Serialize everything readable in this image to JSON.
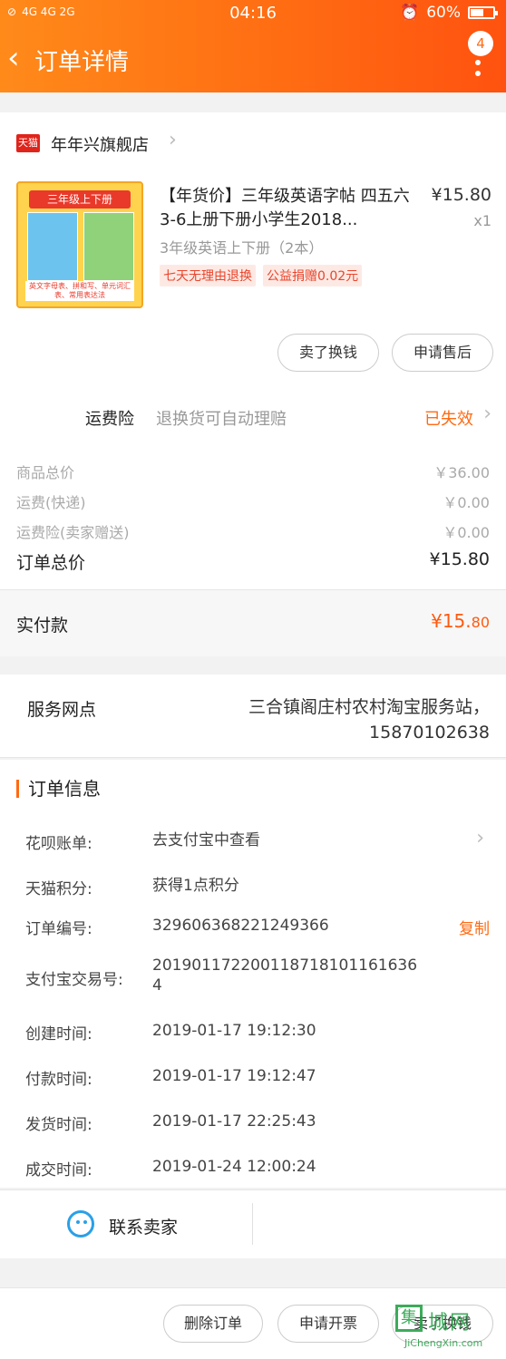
{
  "status_bar": {
    "network": "4G 4G 2G",
    "time": "04:16",
    "battery": "60%",
    "battery_level": 0.6
  },
  "nav": {
    "title": "订单详情",
    "badge": "4"
  },
  "store": {
    "logo_text": "天猫",
    "name": "年年兴旗舰店"
  },
  "product": {
    "title": "【年货价】三年级英语字帖 四五六3-6上册下册小学生2018...",
    "price": "¥15.80",
    "qty": "x1",
    "sku": "3年级英语上下册（2本）",
    "tags": [
      "七天无理由退换",
      "公益捐赠0.02元"
    ],
    "thumb_title": "三年级上下册",
    "thumb_caption": "英文字母表、拼和写、单元词汇表、常用表达法"
  },
  "item_actions": {
    "sell": "卖了换钱",
    "aftersale": "申请售后"
  },
  "insurance": {
    "label": "运费险",
    "desc": "退换货可自动理赔",
    "status": "已失效"
  },
  "fees": {
    "goods_label": "商品总价",
    "goods_value": "￥36.00",
    "shipping_label": "运费(快递)",
    "shipping_value": "￥0.00",
    "insurance_label": "运费险(卖家赠送)",
    "insurance_value": "￥0.00",
    "total_label": "订单总价",
    "total_value": "¥15.80"
  },
  "paid": {
    "label": "实付款",
    "value_int": "¥15.",
    "value_dec": "80"
  },
  "service": {
    "label": "服务网点",
    "line1": "三合镇阁庄村农村淘宝服务站，",
    "line2": "15870102638"
  },
  "order_info": {
    "heading": "订单信息",
    "huabei_label": "花呗账单:",
    "huabei_value": "去支付宝中查看",
    "points_label": "天猫积分:",
    "points_value": "获得1点积分",
    "order_no_label": "订单编号:",
    "order_no_value": "329606368221249366",
    "copy": "复制",
    "alipay_label": "支付宝交易号:",
    "alipay_value": "20190117220011871810116163 64",
    "alipay_line1": "2019011722001187181011616 36",
    "alipay_line1_text": "201901172200118718101161636",
    "alipay_line2_text": "4",
    "created_label": "创建时间:",
    "created_value": "2019-01-17 19:12:30",
    "paid_label": "付款时间:",
    "paid_value": "2019-01-17 19:12:47",
    "shipped_label": "发货时间:",
    "shipped_value": "2019-01-17 22:25:43",
    "closed_label": "成交时间:",
    "closed_value": "2019-01-24 12:00:24"
  },
  "contact": {
    "label": "联系卖家"
  },
  "bottom_actions": {
    "delete": "删除订单",
    "invoice": "申请开票",
    "sell": "卖了换钱"
  },
  "watermark": {
    "mark": "集",
    "text": "城网",
    "url": "JiChengXin.com"
  },
  "colors": {
    "brand_orange": "#ff6a12",
    "price_red": "#ff5a10",
    "tag_red": "#e8452c",
    "contact_blue": "#2aa0e8"
  }
}
